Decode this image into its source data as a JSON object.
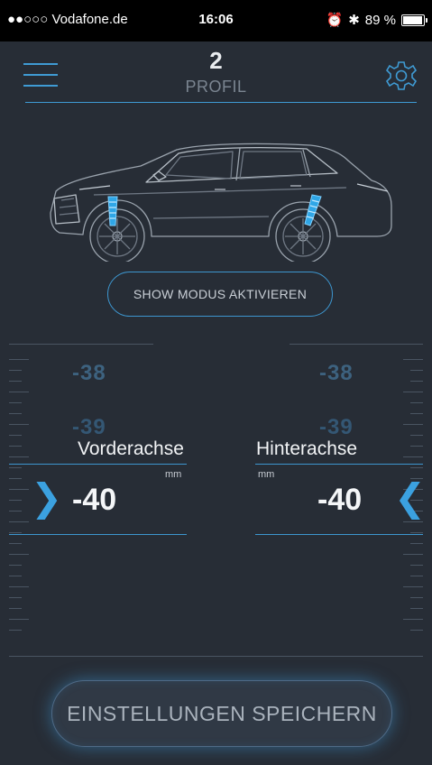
{
  "status_bar": {
    "carrier": "●●○○○ Vodafone.de",
    "time": "16:06",
    "battery": "89 %"
  },
  "header": {
    "profile_number": "2",
    "profile_label": "PROFIL",
    "menu_icon": "hamburger-menu-icon",
    "settings_icon": "gear-icon"
  },
  "show_button": {
    "label": "SHOW MODUS AKTIVIEREN"
  },
  "front_axle": {
    "label": "Vorderachse",
    "unit": "mm",
    "value": "-40",
    "prev_values": [
      "-38",
      "-39"
    ]
  },
  "rear_axle": {
    "label": "Hinterachse",
    "unit": "mm",
    "value": "-40",
    "prev_values": [
      "-38",
      "-39"
    ]
  },
  "save_button": {
    "label": "EINSTELLUNGEN SPEICHERN"
  },
  "colors": {
    "accent": "#3d96cf",
    "background": "#272d36"
  }
}
